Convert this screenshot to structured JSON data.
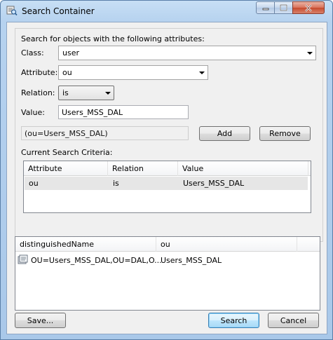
{
  "window": {
    "title": "Search Container"
  },
  "colors": {
    "titlebar": "#b6d2ef",
    "close_button": "#c64a2d",
    "default_button_border": "#3c7fb1",
    "client_bg": "#f0f0f0"
  },
  "icons": {
    "app": "search-container-icon",
    "minimize": "minimize-icon",
    "maximize": "maximize-icon",
    "close": "close-icon",
    "result_item": "container-icon"
  },
  "criteria": {
    "heading": "Search for objects with the following attributes:",
    "class_label": "Class:",
    "class_value": "user",
    "attribute_label": "Attribute:",
    "attribute_value": "ou",
    "relation_label": "Relation:",
    "relation_value": "is",
    "value_label": "Value:",
    "value_value": "Users_MSS_DAL",
    "filter_preview": "(ou=Users_MSS_DAL)",
    "add_label": "Add",
    "remove_label": "Remove",
    "current_label": "Current Search Criteria:",
    "columns": [
      "Attribute",
      "Relation",
      "Value"
    ],
    "rows": [
      {
        "attribute": "ou",
        "relation": "is",
        "value": "Users_MSS_DAL"
      }
    ]
  },
  "results": {
    "columns": [
      "distinguishedName",
      "ou"
    ],
    "rows": [
      {
        "dn": "OU=Users_MSS_DAL,OU=DAL,O...",
        "ou": "Users_MSS_DAL"
      }
    ]
  },
  "footer": {
    "save_label": "Save...",
    "search_label": "Search",
    "cancel_label": "Cancel"
  }
}
